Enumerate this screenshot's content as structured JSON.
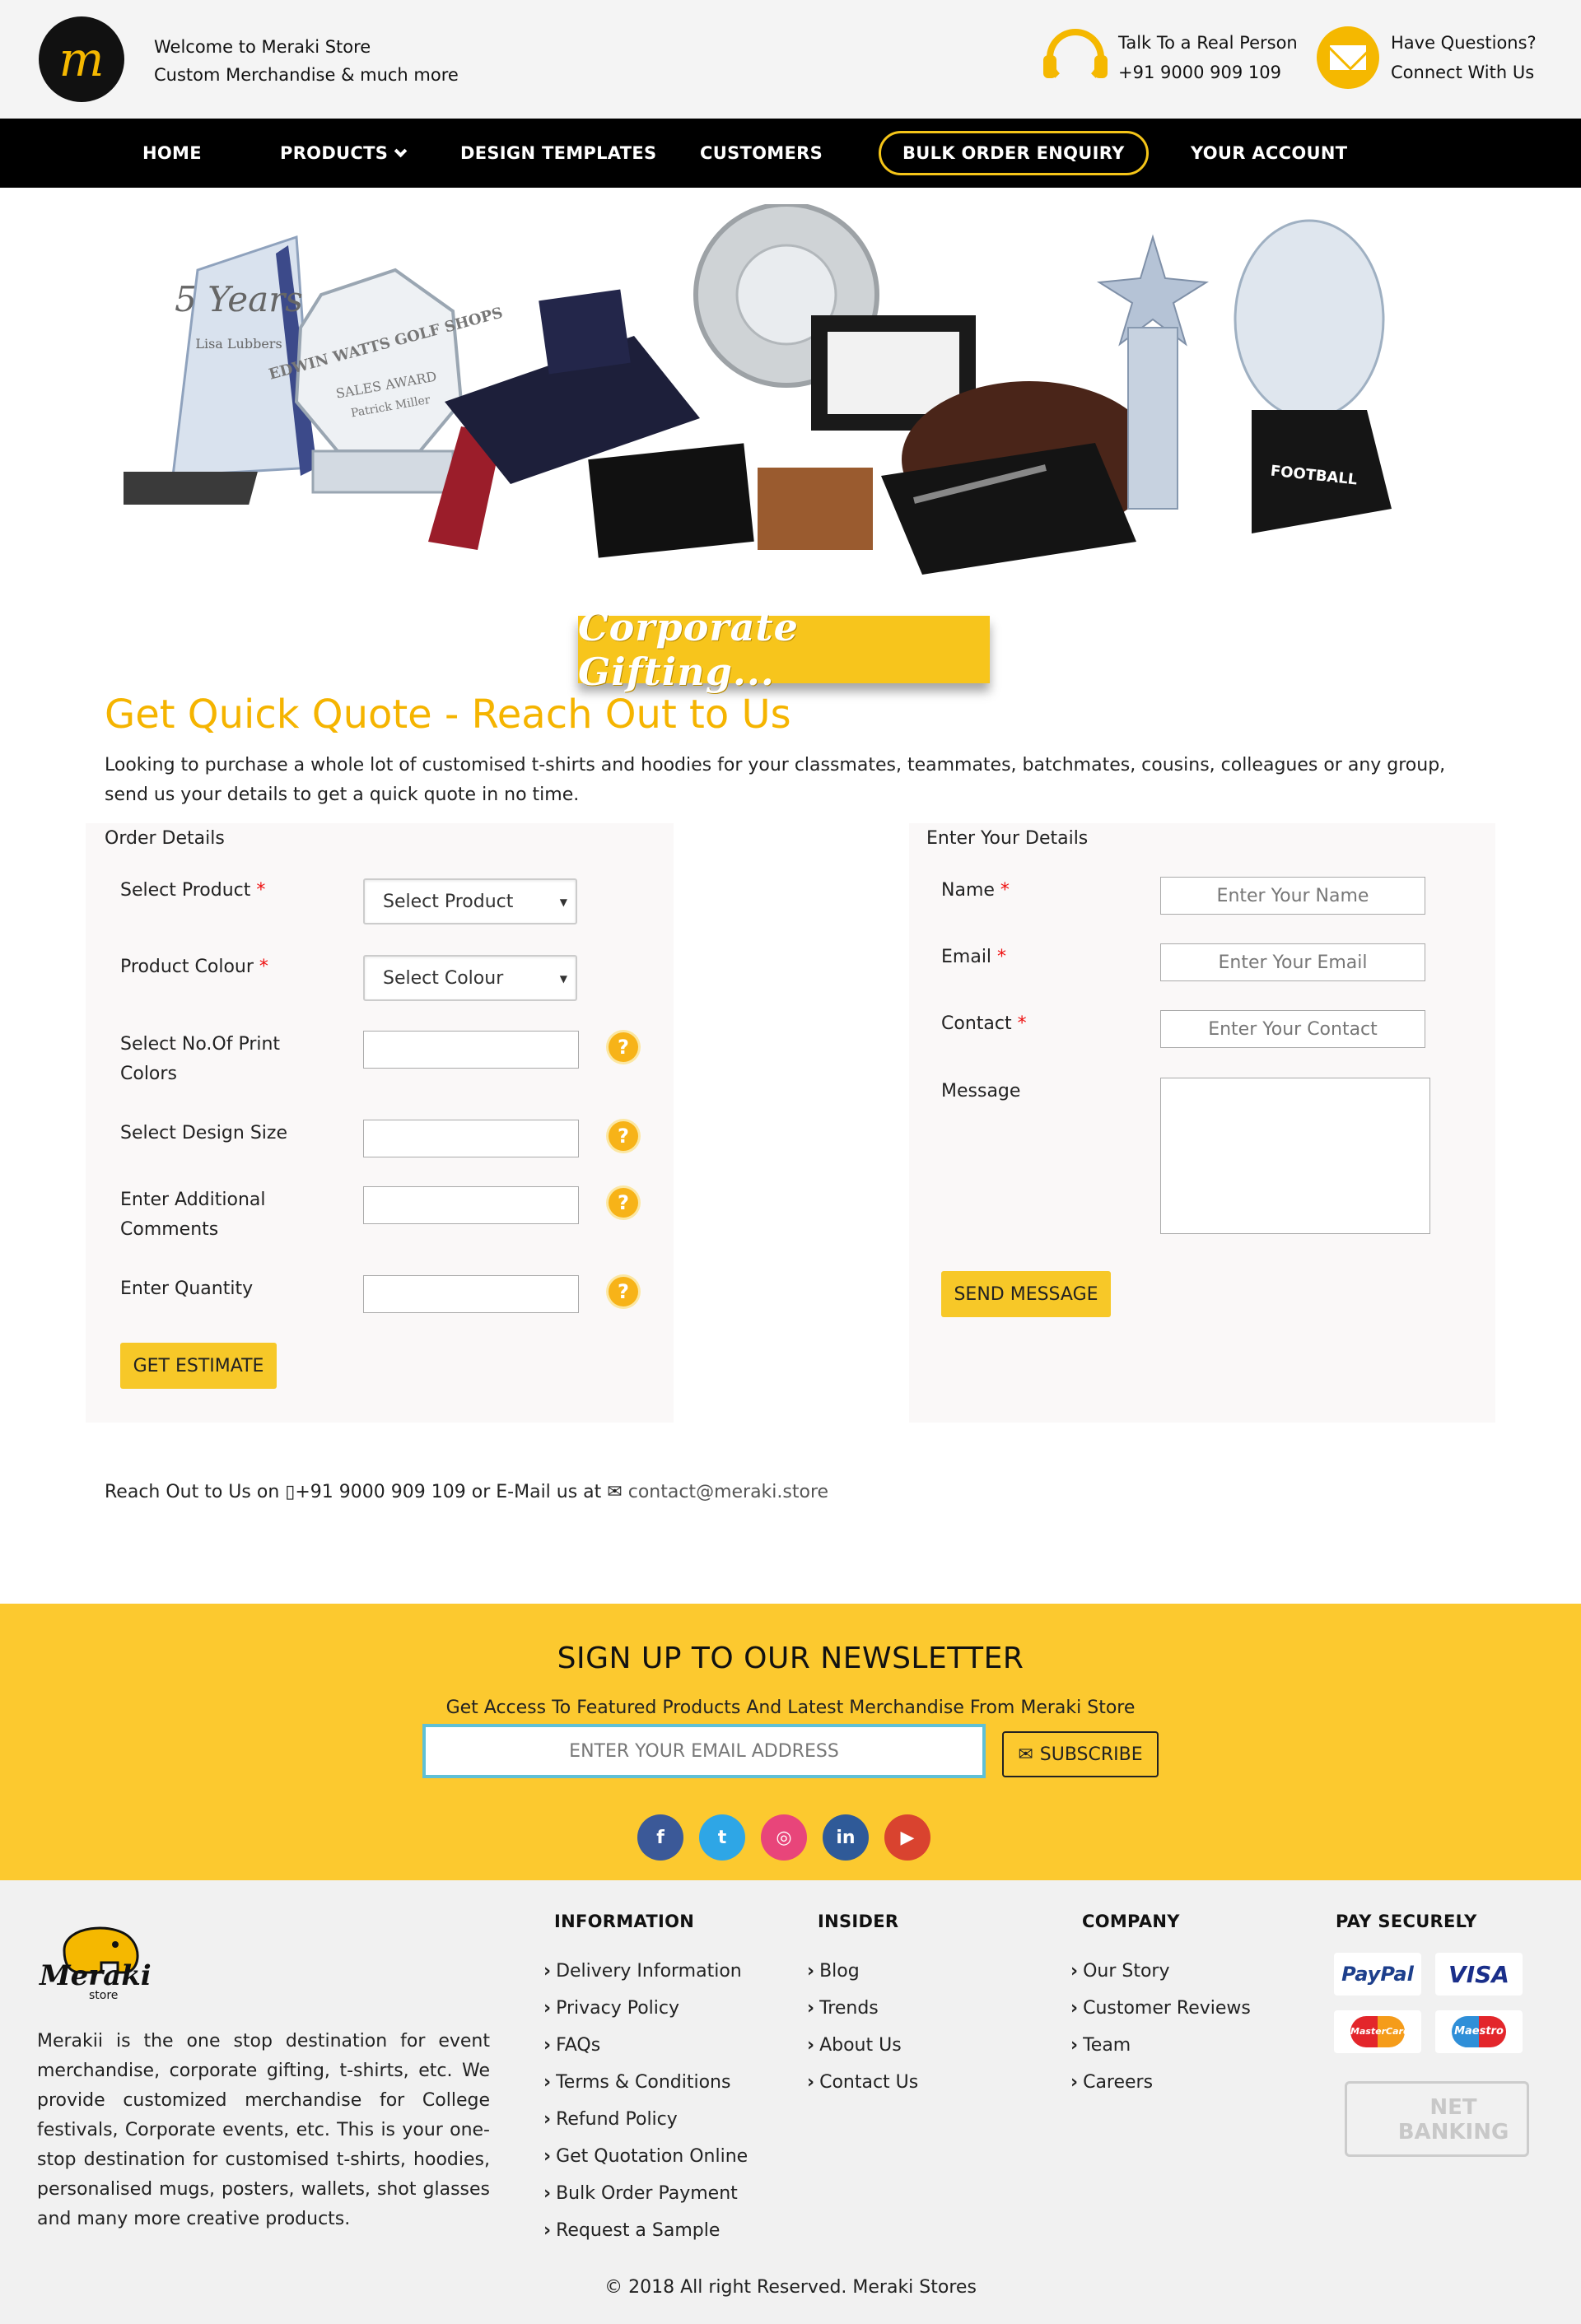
{
  "header": {
    "logo_text": "m",
    "welcome_line1": "Welcome to Meraki Store",
    "welcome_line2": "Custom Merchandise & much more",
    "phone_title": "Talk To a Real Person",
    "phone_number": "+91 9000 909 109",
    "questions_title": "Have Questions?",
    "questions_sub": "Connect With Us"
  },
  "nav": {
    "items": [
      "HOME",
      "PRODUCTS",
      "DESIGN TEMPLATES",
      "CUSTOMERS",
      "BULK ORDER ENQUIRY",
      "YOUR ACCOUNT"
    ]
  },
  "hero": {
    "banner_text": "Corporate Gifting...",
    "trophy_text_1": "5 Years",
    "trophy_text_2": "Lisa Lubbers",
    "trophy_text_3": "EDWIN WATTS GOLF SHOPS",
    "trophy_text_4": "SALES AWARD",
    "trophy_text_5": "Patrick Miller",
    "football_label": "FOOTBALL"
  },
  "quote": {
    "title": "Get Quick Quote - Reach Out to Us",
    "description": "Looking to purchase a whole lot of customised t-shirts and hoodies for your classmates, teammates, batchmates, cousins, colleagues or any group, send us your details to get a quick quote in no time.",
    "order_details_label": "Order Details",
    "your_details_label": "Enter Your Details",
    "select_product_label": "Select Product",
    "select_product_value": "Select Product",
    "product_colour_label": "Product Colour",
    "product_colour_value": "Select Colour",
    "print_colors_label_1": "Select No.Of Print",
    "print_colors_label_2": "Colors",
    "design_size_label": "Select Design Size",
    "comments_label_1": "Enter Additional",
    "comments_label_2": "Comments",
    "quantity_label": "Enter Quantity",
    "required_mark": "*",
    "help_mark": "?",
    "estimate_button": "GET ESTIMATE",
    "name_label": "Name",
    "name_placeholder": "Enter Your Name",
    "email_label": "Email",
    "email_placeholder": "Enter Your Email",
    "contact_label": "Contact",
    "contact_placeholder": "Enter Your Contact",
    "message_label": "Message",
    "send_button": "SEND MESSAGE"
  },
  "reach": {
    "prefix": "Reach Out to Us on",
    "phone": "+91 9000 909 109",
    "middle": "or E-Mail us at",
    "email": "contact@meraki.store"
  },
  "newsletter": {
    "title": "SIGN UP TO OUR NEWSLETTER",
    "subtitle": "Get Access To Featured Products And Latest Merchandise From Meraki Store",
    "input_placeholder": "ENTER YOUR EMAIL ADDRESS",
    "subscribe_button": "SUBSCRIBE",
    "social": [
      {
        "name": "facebook-icon",
        "glyph": "f",
        "color": "#3b5998"
      },
      {
        "name": "twitter-icon",
        "glyph": "t",
        "color": "#2ea6e6"
      },
      {
        "name": "instagram-icon",
        "glyph": "◎",
        "color": "#e8457a"
      },
      {
        "name": "linkedin-icon",
        "glyph": "in",
        "color": "#2f5a98"
      },
      {
        "name": "youtube-icon",
        "glyph": "▶",
        "color": "#d9432f"
      }
    ]
  },
  "footer": {
    "logo_text": "Meraki",
    "logo_sub": "store",
    "about": "Merakii is the one stop destination for event merchandise, corporate gifting, t-shirts, etc. We provide customized merchandise for College festivals, Corporate events, etc. This is your one-stop destination for customised t-shirts, hoodies, personalised mugs, posters, wallets, shot glasses and many more creative products.",
    "information_title": "INFORMATION",
    "information_links": [
      "Delivery Information",
      "Privacy Policy",
      "FAQs",
      "Terms & Conditions",
      "Refund Policy",
      "Get Quotation Online",
      "Bulk Order Payment",
      "Request a Sample"
    ],
    "insider_title": "INSIDER",
    "insider_links": [
      "Blog",
      "Trends",
      "About Us",
      "Contact Us"
    ],
    "company_title": "COMPANY",
    "company_links": [
      "Our Story",
      "Customer Reviews",
      "Team",
      "Careers"
    ],
    "pay_title": "PAY SECURELY",
    "pay_methods": [
      "PayPal",
      "VISA",
      "MasterCard",
      "Maestro"
    ],
    "netbanking_1": "NET",
    "netbanking_2": "BANKING",
    "copyright": "© 2018 All right Reserved.  Meraki Stores"
  },
  "colors": {
    "accent": "#f7c828",
    "nav_bg": "#000000",
    "title": "#f5b400",
    "newsletter_bg": "#fcc92f"
  }
}
